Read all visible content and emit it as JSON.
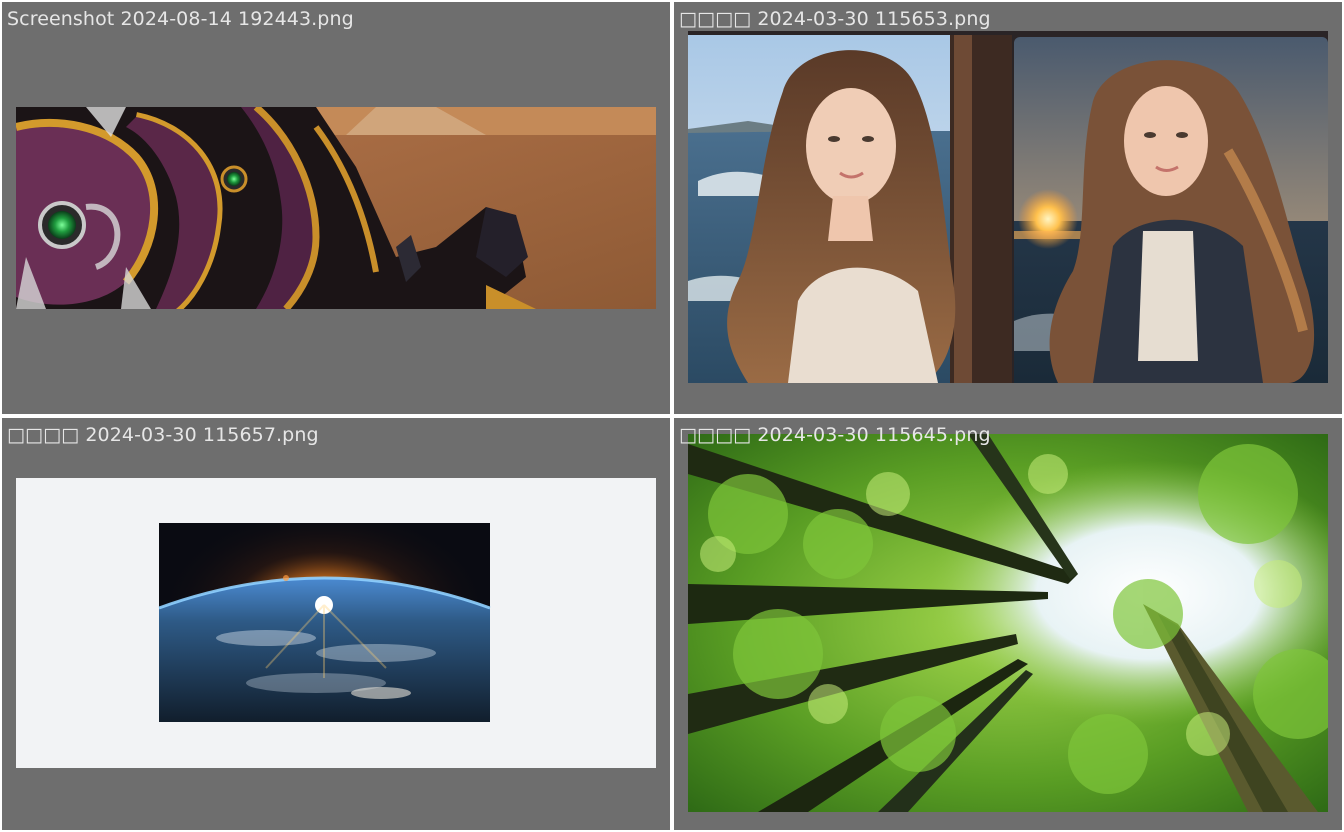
{
  "gallery": {
    "items": [
      {
        "filename": "Screenshot 2024-08-14 192443.png",
        "thumbnail": "game-character-armor-closeup"
      },
      {
        "filename": "□□□□ 2024-03-30 115653.png",
        "thumbnail": "two-women-long-hair-seaside"
      },
      {
        "filename": "□□□□ 2024-03-30 115657.png",
        "thumbnail": "earth-sunrise-from-space"
      },
      {
        "filename": "□□□□ 2024-03-30 115645.png",
        "thumbnail": "forest-canopy-looking-up"
      }
    ]
  },
  "colors": {
    "cell_background": "#6e6e6e",
    "gutter": "#ffffff",
    "caption_text": "#e6e6e6"
  }
}
